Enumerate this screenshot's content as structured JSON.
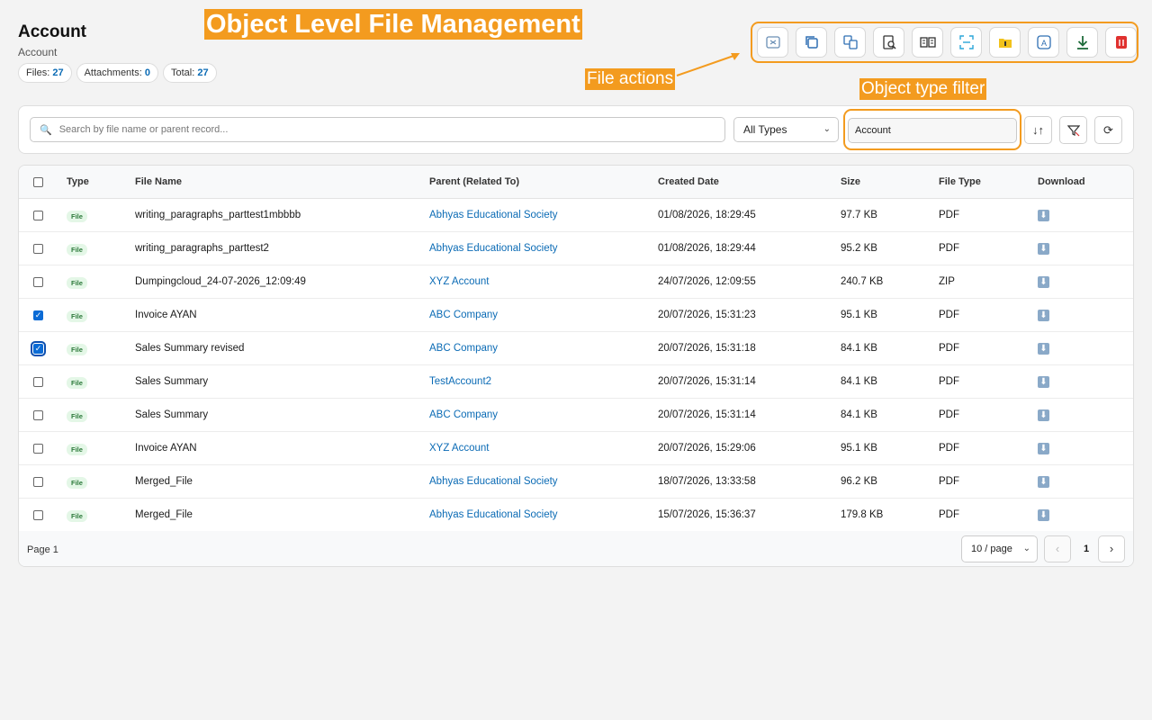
{
  "header": {
    "title": "Account",
    "subtitle": "Account"
  },
  "stats": [
    {
      "label": "Files:",
      "value": "27"
    },
    {
      "label": "Attachments:",
      "value": "0"
    },
    {
      "label": "Total:",
      "value": "27"
    }
  ],
  "annotations": {
    "title": "Object Level File Management",
    "file_actions": "File actions",
    "object_filter": "Object type filter"
  },
  "toolbar": {
    "buttons": [
      {
        "name": "convert-image-icon",
        "color": "#6a8fb5"
      },
      {
        "name": "copy-icon",
        "color": "#2f6fb3"
      },
      {
        "name": "merge-icon",
        "color": "#2f6fb3"
      },
      {
        "name": "preview-doc-icon",
        "color": "#333333"
      },
      {
        "name": "compare-icon",
        "color": "#333333"
      },
      {
        "name": "scan-icon",
        "color": "#2aa6d9"
      },
      {
        "name": "folder-icon",
        "color": "#f2c21b"
      },
      {
        "name": "translate-icon",
        "color": "#2f6fb3"
      },
      {
        "name": "download-icon",
        "color": "#1e6b3a"
      },
      {
        "name": "delete-icon",
        "color": "#e0312f"
      }
    ]
  },
  "filters": {
    "search_placeholder": "Search by file name or parent record...",
    "type_select": "All Types",
    "object_type": "Account"
  },
  "table": {
    "headers": {
      "type": "Type",
      "name": "File Name",
      "parent": "Parent (Related To)",
      "created": "Created Date",
      "size": "Size",
      "file_type": "File Type",
      "download": "Download"
    },
    "rows": [
      {
        "checked": false,
        "type": "File",
        "name": "writing_paragraphs_parttest1mbbbb",
        "parent": "Abhyas Educational Society",
        "created": "01/08/2026, 18:29:45",
        "size": "97.7 KB",
        "file_type": "PDF"
      },
      {
        "checked": false,
        "type": "File",
        "name": "writing_paragraphs_parttest2",
        "parent": "Abhyas Educational Society",
        "created": "01/08/2026, 18:29:44",
        "size": "95.2 KB",
        "file_type": "PDF"
      },
      {
        "checked": false,
        "type": "File",
        "name": "Dumpingcloud_24-07-2026_12:09:49",
        "parent": "XYZ Account",
        "created": "24/07/2026, 12:09:55",
        "size": "240.7 KB",
        "file_type": "ZIP"
      },
      {
        "checked": true,
        "type": "File",
        "name": "Invoice AYAN",
        "parent": "ABC Company",
        "created": "20/07/2026, 15:31:23",
        "size": "95.1 KB",
        "file_type": "PDF"
      },
      {
        "checked": true,
        "focused": true,
        "type": "File",
        "name": "Sales Summary revised",
        "parent": "ABC Company",
        "created": "20/07/2026, 15:31:18",
        "size": "84.1 KB",
        "file_type": "PDF"
      },
      {
        "checked": false,
        "type": "File",
        "name": "Sales Summary",
        "parent": "TestAccount2",
        "created": "20/07/2026, 15:31:14",
        "size": "84.1 KB",
        "file_type": "PDF"
      },
      {
        "checked": false,
        "type": "File",
        "name": "Sales Summary",
        "parent": "ABC Company",
        "created": "20/07/2026, 15:31:14",
        "size": "84.1 KB",
        "file_type": "PDF"
      },
      {
        "checked": false,
        "type": "File",
        "name": "Invoice AYAN",
        "parent": "XYZ Account",
        "created": "20/07/2026, 15:29:06",
        "size": "95.1 KB",
        "file_type": "PDF"
      },
      {
        "checked": false,
        "type": "File",
        "name": "Merged_File",
        "parent": "Abhyas Educational Society",
        "created": "18/07/2026, 13:33:58",
        "size": "96.2 KB",
        "file_type": "PDF"
      },
      {
        "checked": false,
        "type": "File",
        "name": "Merged_File",
        "parent": "Abhyas Educational Society",
        "created": "15/07/2026, 15:36:37",
        "size": "179.8 KB",
        "file_type": "PDF"
      }
    ]
  },
  "pagination": {
    "page_label": "Page 1",
    "per_page": "10 / page",
    "current": "1",
    "prev": "‹",
    "next": "›"
  },
  "colors": {
    "accent": "#f39b1f",
    "link": "#0b6bb5",
    "checkbox": "#0b6bd5"
  }
}
